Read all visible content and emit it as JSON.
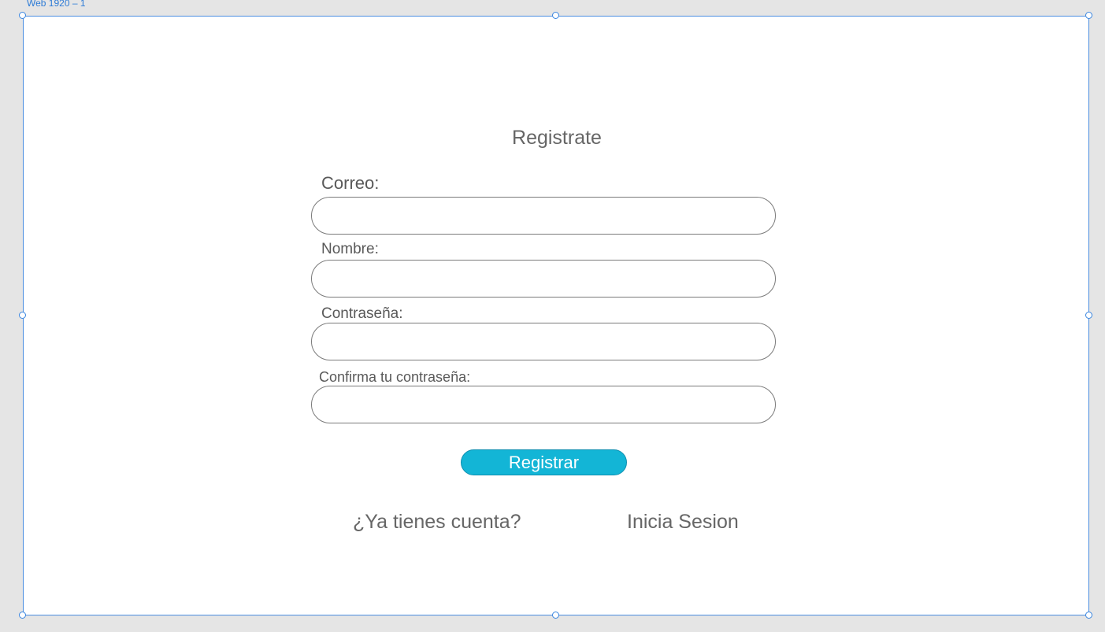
{
  "artboard": {
    "label": "Web 1920 – 1"
  },
  "form": {
    "title": "Registrate",
    "fields": [
      {
        "label": "Correo:",
        "value": "",
        "placeholder": ""
      },
      {
        "label": "Nombre:",
        "value": "",
        "placeholder": ""
      },
      {
        "label": "Contraseña:",
        "value": "",
        "placeholder": ""
      },
      {
        "label": "Confirma tu contraseña:",
        "value": "",
        "placeholder": ""
      }
    ],
    "submit_label": "Registrar"
  },
  "footer": {
    "question": "¿Ya tienes cuenta?",
    "login_link": "Inicia Sesion"
  },
  "colors": {
    "accent": "#13b5d6",
    "selection": "#4a8de0",
    "text": "#666666"
  }
}
